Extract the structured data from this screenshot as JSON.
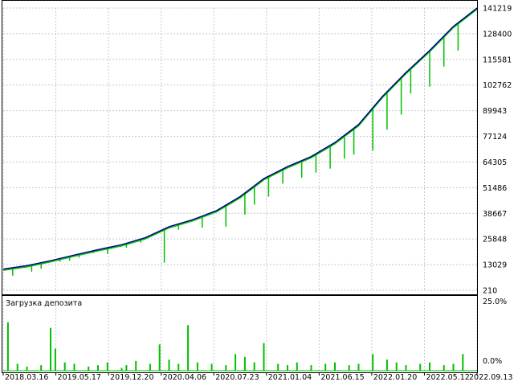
{
  "chart_data": [
    {
      "type": "line",
      "title": "",
      "grid": true,
      "ylim": [
        210,
        141219
      ],
      "y_ticks": [
        141219,
        128400,
        115581,
        102762,
        89943,
        77124,
        64305,
        51486,
        38667,
        25848,
        13029,
        210
      ],
      "x_ticks": [
        "2018.03.16",
        "2019.05.17",
        "2019.12.20",
        "2020.04.06",
        "2020.07.23",
        "2021.01.04",
        "2021.06.15",
        "2022.01.20",
        "2022.05.12",
        "2022.09.13"
      ],
      "series": [
        {
          "color": "#00008b",
          "x": [
            0,
            0.05,
            0.1,
            0.15,
            0.2,
            0.25,
            0.3,
            0.35,
            0.4,
            0.45,
            0.5,
            0.55,
            0.6,
            0.65,
            0.7,
            0.75,
            0.8,
            0.85,
            0.9,
            0.95,
            1.0
          ],
          "values": [
            10800,
            12500,
            15000,
            17800,
            20500,
            23000,
            26500,
            32000,
            35500,
            40000,
            47000,
            56000,
            62000,
            67000,
            74000,
            83000,
            97000,
            109000,
            120000,
            132000,
            141219
          ]
        },
        {
          "color": "#00c000",
          "x": [
            0.02,
            0.06,
            0.08,
            0.12,
            0.14,
            0.16,
            0.19,
            0.22,
            0.26,
            0.29,
            0.33,
            0.34,
            0.37,
            0.42,
            0.47,
            0.51,
            0.53,
            0.56,
            0.59,
            0.63,
            0.66,
            0.69,
            0.72,
            0.74,
            0.78,
            0.81,
            0.84,
            0.86,
            0.9,
            0.93,
            0.96
          ],
          "values": [
            7500,
            9500,
            11000,
            14500,
            15000,
            16500,
            18800,
            18500,
            21500,
            24000,
            29000,
            14000,
            30500,
            31500,
            32000,
            38000,
            43000,
            47000,
            53500,
            56500,
            59000,
            61000,
            66000,
            68000,
            70000,
            80500,
            88000,
            98500,
            102000,
            112000,
            120000
          ]
        }
      ],
      "series_kind": [
        "balance",
        "equity"
      ]
    },
    {
      "type": "bar",
      "title": "Загрузка депозита",
      "ylim": [
        0,
        25
      ],
      "y_ticks": [
        "25.0%",
        "0.0%"
      ],
      "x": [
        0.01,
        0.03,
        0.05,
        0.08,
        0.1,
        0.11,
        0.13,
        0.15,
        0.18,
        0.2,
        0.22,
        0.25,
        0.26,
        0.28,
        0.31,
        0.33,
        0.35,
        0.37,
        0.39,
        0.41,
        0.44,
        0.47,
        0.49,
        0.51,
        0.53,
        0.55,
        0.58,
        0.6,
        0.62,
        0.65,
        0.68,
        0.7,
        0.73,
        0.75,
        0.78,
        0.81,
        0.83,
        0.85,
        0.88,
        0.9,
        0.93,
        0.95,
        0.97
      ],
      "values": [
        17.5,
        2.5,
        1.5,
        2,
        15.5,
        8,
        3,
        2.5,
        1.5,
        2,
        3,
        1,
        2,
        3.5,
        2.5,
        9.5,
        4,
        2.5,
        16.5,
        3,
        2.5,
        2,
        6,
        5,
        3,
        10,
        2.5,
        2,
        3,
        2,
        2.5,
        3,
        2,
        2.5,
        6,
        4,
        3,
        2,
        2.5,
        3,
        2,
        2.5,
        6
      ]
    }
  ]
}
